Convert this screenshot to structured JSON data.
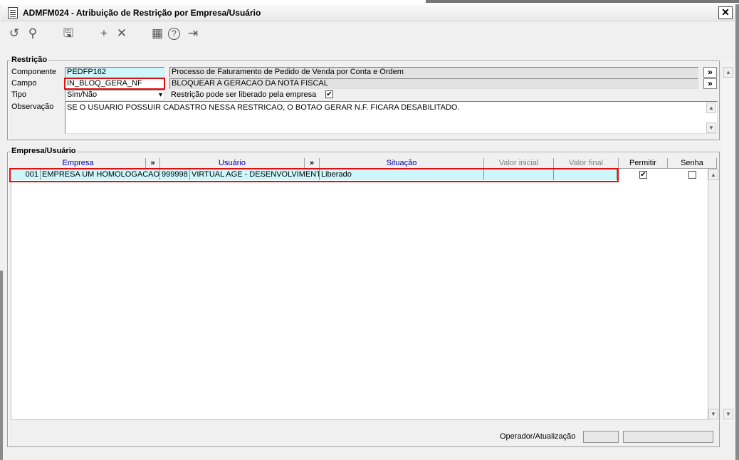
{
  "window": {
    "title": "ADMFM024 - Atribuição de Restrição por Empresa/Usuário",
    "close_label": "✕"
  },
  "toolbar": {
    "icons": [
      "refresh-icon",
      "search-icon",
      "save-icon",
      "add-icon",
      "delete-icon",
      "calendar-icon",
      "help-icon",
      "exit-icon"
    ],
    "glyphs": {
      "refresh": "↺",
      "search": "⚲",
      "save": "🖫",
      "add": "+",
      "delete": "✕",
      "calendar": "▦",
      "help": "?",
      "exit": "⇥"
    }
  },
  "restricao": {
    "group_label": "Restrição",
    "componente_label": "Componente",
    "componente_value": "PEDFP162",
    "componente_desc": "Processo de Faturamento de Pedido de Venda por Conta e Ordem",
    "campo_label": "Campo",
    "campo_value": "IN_BLOQ_GERA_NF",
    "campo_desc": "BLOQUEAR A GERACAO DA NOTA FISCAL",
    "tipo_label": "Tipo",
    "tipo_value": "Sim/Não",
    "liberado_label": "Restrição pode ser liberado pela empresa",
    "liberado_checked": "✔",
    "observacao_label": "Observação",
    "observacao_value": "SE O USUARIO POSSUIR CADASTRO NESSA RESTRICAO, O BOTAO GERAR N.F. FICARA DESABILITADO.",
    "arrow": "»",
    "dropdown_arrow": "▾"
  },
  "empresa_usuario": {
    "group_label": "Empresa/Usuário",
    "columns": {
      "empresa": "Empresa",
      "usuario": "Usuário",
      "situacao": "Situação",
      "valor_inicial": "Valor inicial",
      "valor_final": "Valor final",
      "permitir": "Permitir",
      "senha": "Senha",
      "expand": "»"
    },
    "rows": [
      {
        "empresa_codigo": "001",
        "empresa_nome": "EMPRESA UM HOMOLOGACAO",
        "usuario_codigo": "999998",
        "usuario_nome": "VIRTUAL AGE - DESENVOLVIMENTO",
        "situacao": "Liberado",
        "valor_inicial": "",
        "valor_final": "",
        "permitir": "✔",
        "senha": ""
      }
    ]
  },
  "footer": {
    "operador_label": "Operador/Atualização"
  },
  "scroll": {
    "up": "▲",
    "down": "▼"
  },
  "colors": {
    "highlight_cyan": "#cdf7fb",
    "header_blue": "#0000a8",
    "outline_red": "#e01010"
  }
}
